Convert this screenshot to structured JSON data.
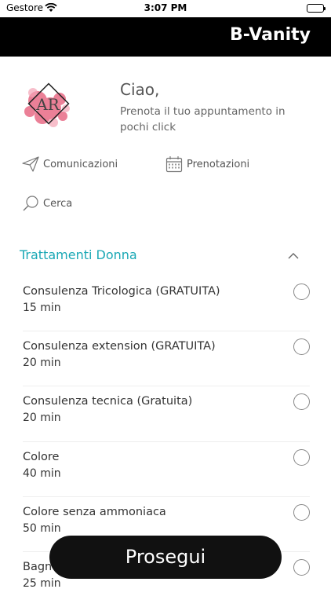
{
  "status_bar": {
    "carrier": "Gestore",
    "time": "3:07 PM"
  },
  "header": {
    "brand": "B-Vanity"
  },
  "profile": {
    "logo_text": "AR",
    "greeting": "Ciao,",
    "subtitle": "Prenota il tuo appuntamento in pochi click"
  },
  "actions": {
    "communications": "Comunicazioni",
    "bookings": "Prenotazioni",
    "search": "Cerca"
  },
  "section": {
    "title": "Trattamenti Donna",
    "accent_color": "#1aa8b5"
  },
  "services": [
    {
      "name": "Consulenza Tricologica (GRATUITA)",
      "duration": "15 min"
    },
    {
      "name": "Consulenza extension (GRATUITA)",
      "duration": "20 min"
    },
    {
      "name": "Consulenza tecnica (Gratuita)",
      "duration": "20 min"
    },
    {
      "name": "Colore",
      "duration": "40 min"
    },
    {
      "name": "Colore senza ammoniaca",
      "duration": "50 min"
    },
    {
      "name": "Bagno di colore",
      "duration": "25 min"
    }
  ],
  "cta": {
    "label": "Prosegui"
  }
}
